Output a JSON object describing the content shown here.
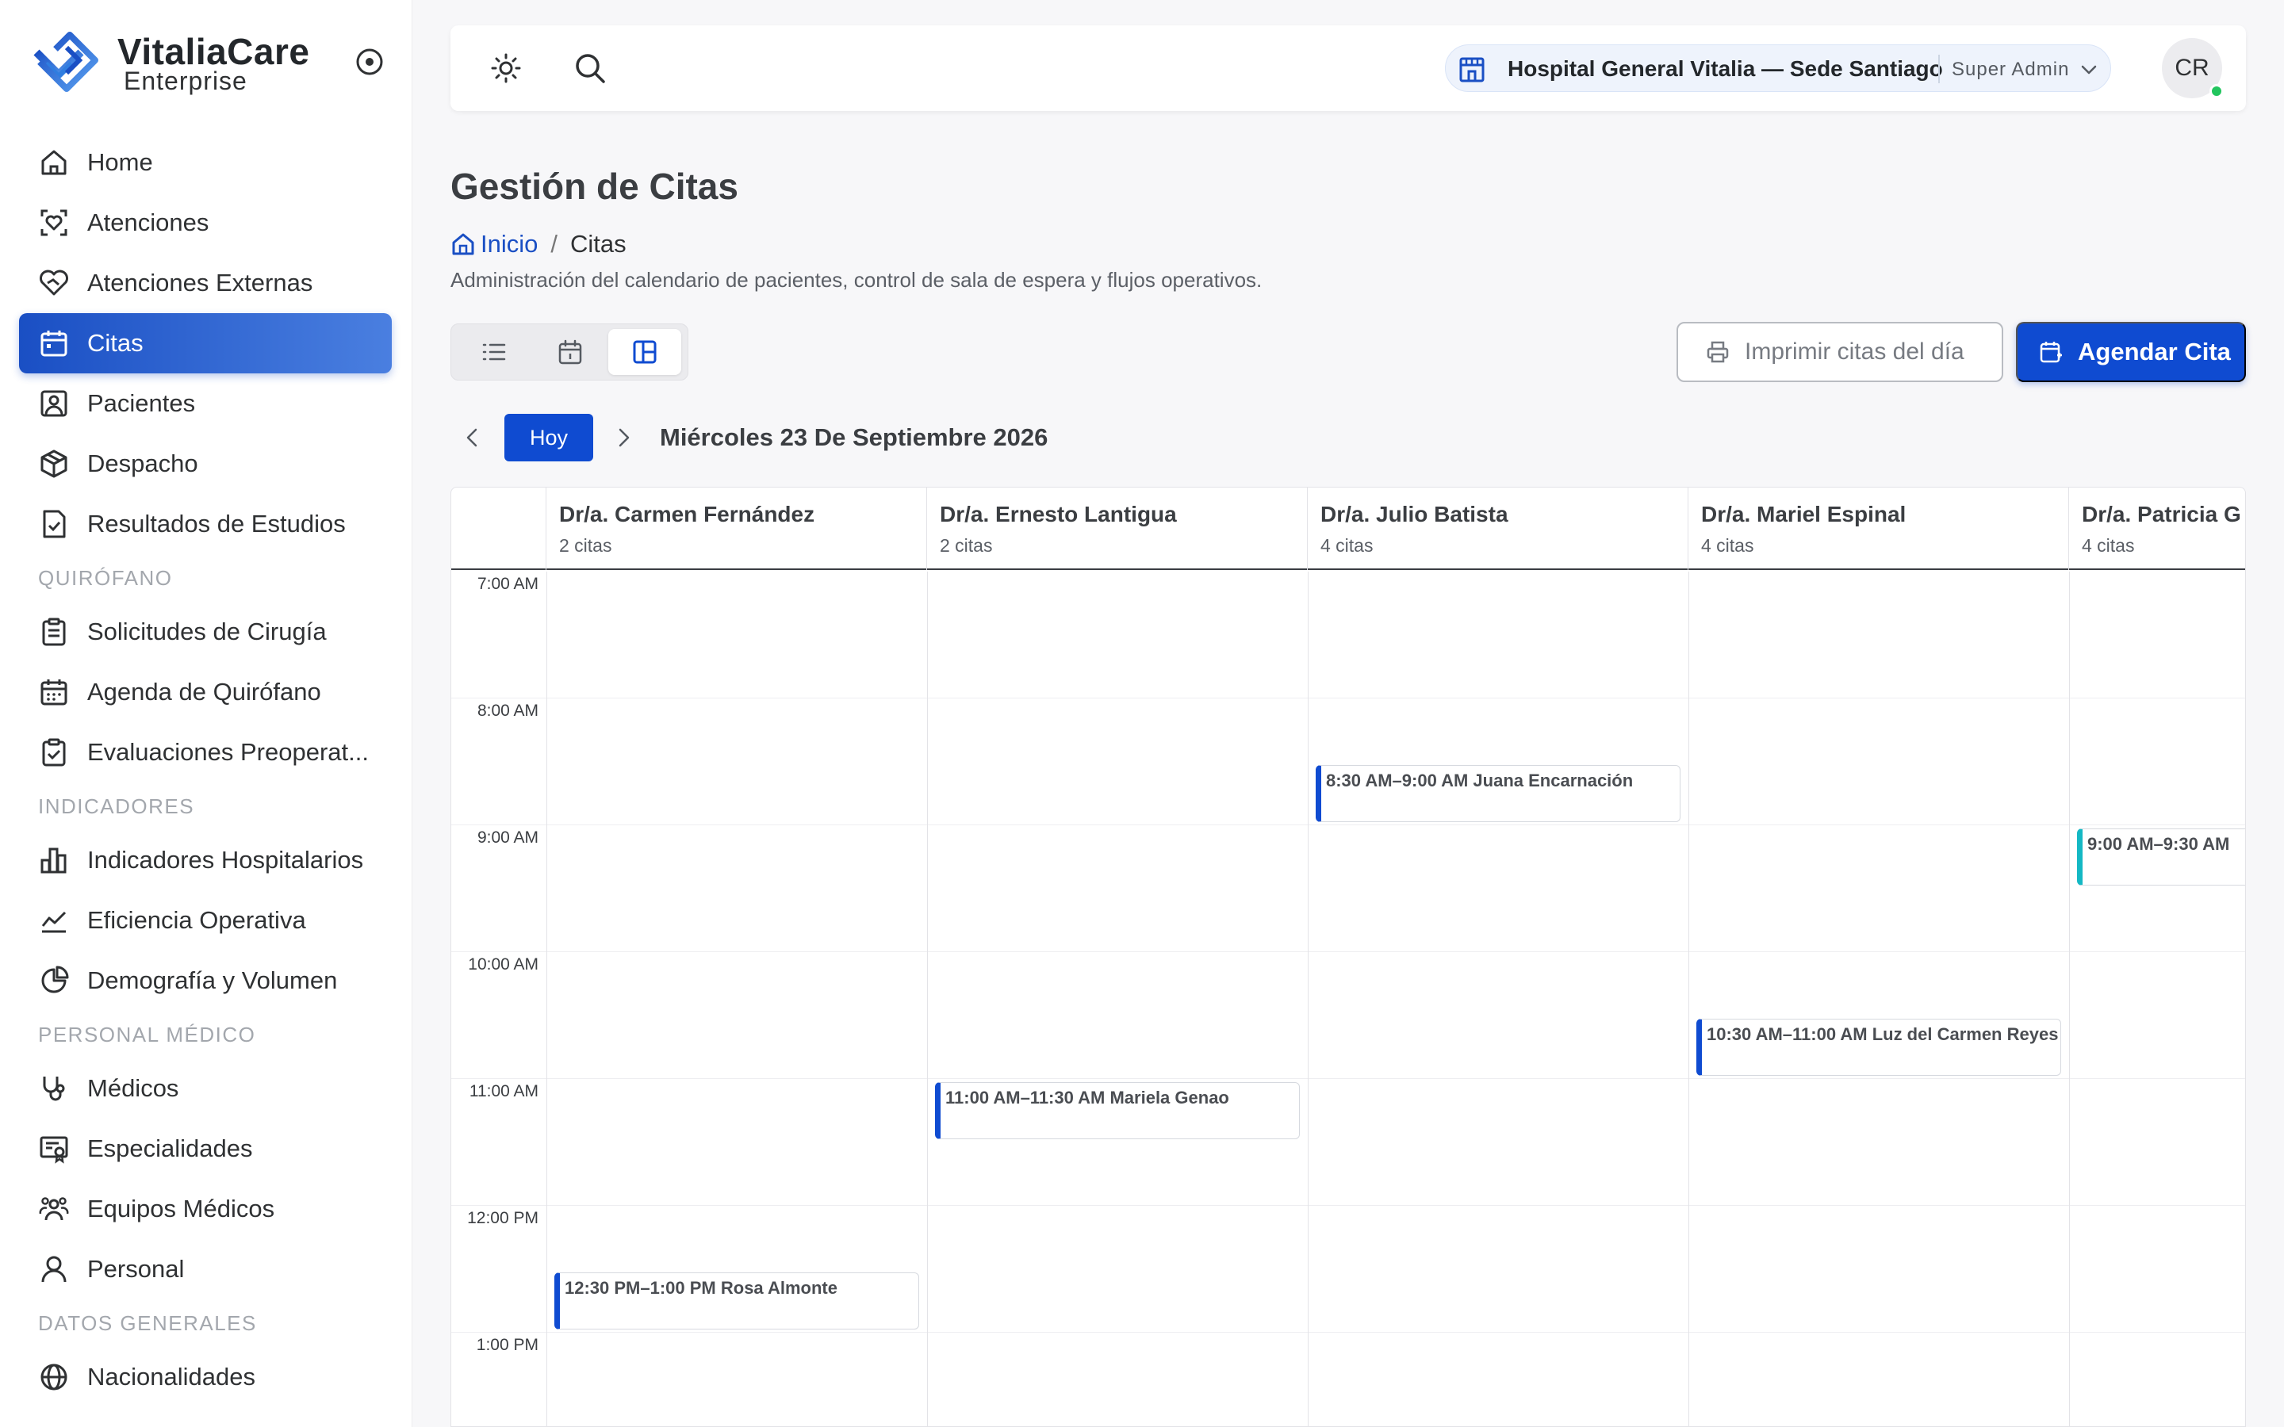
{
  "brand": {
    "name": "VitaliaCare",
    "sub": "Enterprise"
  },
  "sidebar": {
    "items": [
      {
        "label": "Home",
        "icon": "home-icon"
      },
      {
        "label": "Atenciones",
        "icon": "scan-heart-icon"
      },
      {
        "label": "Atenciones Externas",
        "icon": "handshake-heart-icon"
      },
      {
        "label": "Citas",
        "icon": "calendar-icon",
        "active": true
      },
      {
        "label": "Pacientes",
        "icon": "user-square-icon"
      },
      {
        "label": "Despacho",
        "icon": "package-icon"
      },
      {
        "label": "Resultados de Estudios",
        "icon": "file-check-icon"
      }
    ],
    "sections": [
      {
        "title": "QUIRÓFANO",
        "items": [
          {
            "label": "Solicitudes de Cirugía",
            "icon": "clipboard-list-icon"
          },
          {
            "label": "Agenda de Quirófano",
            "icon": "calendar-days-icon"
          },
          {
            "label": "Evaluaciones Preoperat...",
            "icon": "clipboard-check-icon"
          }
        ]
      },
      {
        "title": "INDICADORES",
        "items": [
          {
            "label": "Indicadores Hospitalarios",
            "icon": "bar-chart-icon"
          },
          {
            "label": "Eficiencia Operativa",
            "icon": "line-chart-icon"
          },
          {
            "label": "Demografía y Volumen",
            "icon": "pie-chart-icon"
          }
        ]
      },
      {
        "title": "PERSONAL MÉDICO",
        "items": [
          {
            "label": "Médicos",
            "icon": "stethoscope-icon"
          },
          {
            "label": "Especialidades",
            "icon": "certificate-icon"
          },
          {
            "label": "Equipos Médicos",
            "icon": "users-group-icon"
          },
          {
            "label": "Personal",
            "icon": "user-icon"
          }
        ]
      },
      {
        "title": "DATOS GENERALES",
        "items": [
          {
            "label": "Nacionalidades",
            "icon": "globe-icon"
          }
        ]
      }
    ]
  },
  "topbar": {
    "hospital": "Hospital General Vitalia — Sede Santiago",
    "role": "Super Admin",
    "avatar_initials": "CR"
  },
  "page": {
    "title": "Gestión de Citas",
    "breadcrumb_home": "Inicio",
    "breadcrumb_sep": "/",
    "breadcrumb_current": "Citas",
    "description": "Administración del calendario de pacientes, control de sala de espera y flujos operativos."
  },
  "actions": {
    "print_label": "Imprimir citas del día",
    "add_label": "Agendar Cita"
  },
  "date_nav": {
    "today_label": "Hoy",
    "current_date": "Miércoles 23 De Septiembre 2026"
  },
  "calendar": {
    "hours": [
      "7:00 AM",
      "8:00 AM",
      "9:00 AM",
      "10:00 AM",
      "11:00 AM",
      "12:00 PM",
      "1:00 PM"
    ],
    "doctors": [
      {
        "name": "Dr/a. Carmen Fernández",
        "count": "2 citas"
      },
      {
        "name": "Dr/a. Ernesto Lantigua",
        "count": "2 citas"
      },
      {
        "name": "Dr/a. Julio Batista",
        "count": "4 citas"
      },
      {
        "name": "Dr/a. Mariel Espinal",
        "count": "4 citas"
      },
      {
        "name": "Dr/a. Patricia G",
        "count": "4 citas"
      }
    ],
    "events": [
      {
        "doctor": 2,
        "start": 8.5,
        "label": "8:30 AM–9:00 AM Juana Encarnación",
        "color": "#0f4bd1"
      },
      {
        "doctor": 4,
        "start": 9.0,
        "label": "9:00 AM–9:30 AM",
        "color": "#14b8c4"
      },
      {
        "doctor": 3,
        "start": 10.5,
        "label": "10:30 AM–11:00 AM Luz del Carmen Reyes",
        "color": "#0f4bd1"
      },
      {
        "doctor": 1,
        "start": 11.0,
        "label": "11:00 AM–11:30 AM Mariela Genao",
        "color": "#0f4bd1"
      },
      {
        "doctor": 0,
        "start": 12.5,
        "label": "12:30 PM–1:00 PM Rosa Almonte",
        "color": "#0f4bd1"
      }
    ]
  }
}
